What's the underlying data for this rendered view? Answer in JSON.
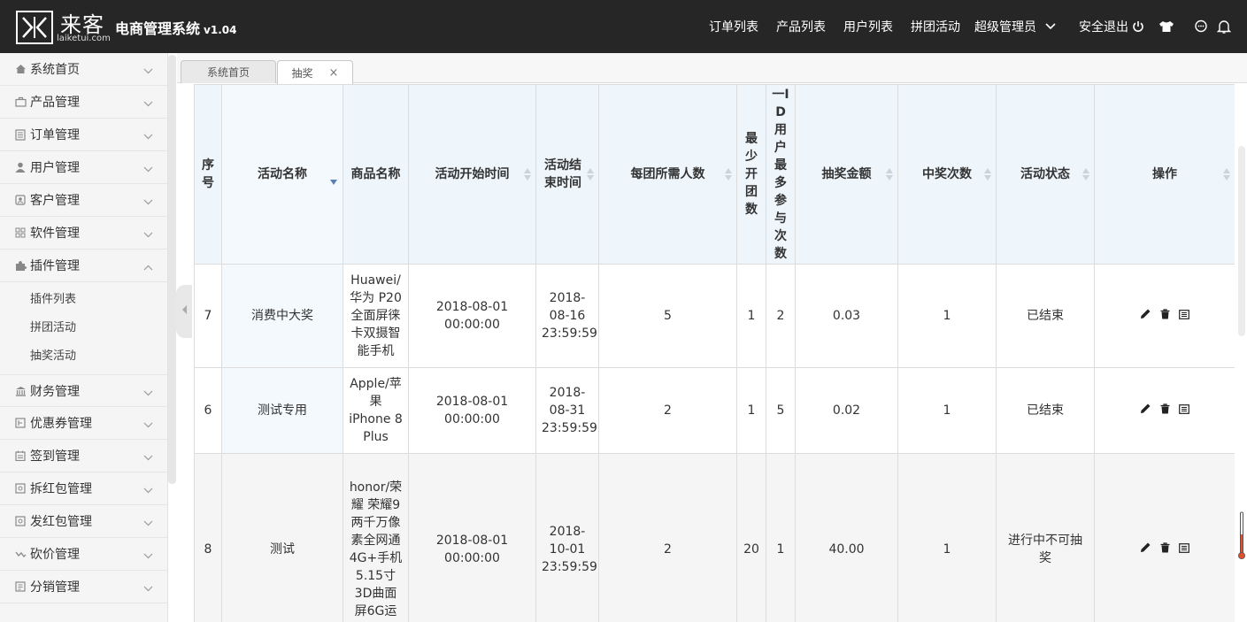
{
  "brand": {
    "logo_cn": "来客",
    "logo_en": "laiketui.com",
    "title": "电商管理系统",
    "version": "v1.04"
  },
  "topnav": {
    "items": [
      "订单列表",
      "产品列表",
      "用户列表",
      "拼团活动"
    ],
    "admin": "超级管理员",
    "logout": "安全退出"
  },
  "sidebar": {
    "items": [
      {
        "label": "系统首页",
        "icon": "home-icon"
      },
      {
        "label": "产品管理",
        "icon": "briefcase-icon"
      },
      {
        "label": "订单管理",
        "icon": "list-icon"
      },
      {
        "label": "用户管理",
        "icon": "user-icon"
      },
      {
        "label": "客户管理",
        "icon": "contact-icon"
      },
      {
        "label": "软件管理",
        "icon": "grid-icon"
      },
      {
        "label": "插件管理",
        "icon": "puzzle-icon"
      },
      {
        "label": "财务管理",
        "icon": "bank-icon"
      },
      {
        "label": "优惠券管理",
        "icon": "coupon-icon"
      },
      {
        "label": "签到管理",
        "icon": "calendar-icon"
      },
      {
        "label": "拆红包管理",
        "icon": "redpacket-icon"
      },
      {
        "label": "发红包管理",
        "icon": "redpacket-icon"
      },
      {
        "label": "砍价管理",
        "icon": "trend-icon"
      },
      {
        "label": "分销管理",
        "icon": "share-icon"
      }
    ],
    "plugin_submenu": [
      "插件列表",
      "拼团活动",
      "抽奖活动"
    ]
  },
  "tabs": [
    {
      "label": "系统首页"
    },
    {
      "label": "抽奖",
      "close": "×"
    }
  ],
  "table": {
    "headers": [
      "序号",
      "活动名称",
      "商品名称",
      "活动开始时间",
      "活动结束时间",
      "每团所需人数",
      "最少开团数",
      "一ID用户最多参与次数",
      "抽奖金额",
      "中奖次数",
      "活动状态",
      "操作"
    ],
    "rows": [
      {
        "id": "7",
        "name": "消费中大奖",
        "product": "Huawei/华为 P20全面屏徕卡双摄智能手机",
        "start": "2018-08-01 00:00:00",
        "end": "2018-08-16 23:59:59",
        "group_size": "5",
        "min_groups": "1",
        "max_times": "2",
        "amount": "0.03",
        "wins": "1",
        "status": "已结束"
      },
      {
        "id": "6",
        "name": "测试专用",
        "product": "Apple/苹果 iPhone 8 Plus",
        "start": "2018-08-01 00:00:00",
        "end": "2018-08-31 23:59:59",
        "group_size": "2",
        "min_groups": "1",
        "max_times": "5",
        "amount": "0.02",
        "wins": "1",
        "status": "已结束"
      },
      {
        "id": "8",
        "name": "测试",
        "product": "honor/荣耀 荣耀9 两千万像素全网通4G+手机 5.15寸3D曲面屏6G运",
        "start": "2018-08-01 00:00:00",
        "end": "2018-10-01 23:59:59",
        "group_size": "2",
        "min_groups": "20",
        "max_times": "1",
        "amount": "40.00",
        "wins": "1",
        "status": "进行中不可抽奖"
      }
    ]
  }
}
